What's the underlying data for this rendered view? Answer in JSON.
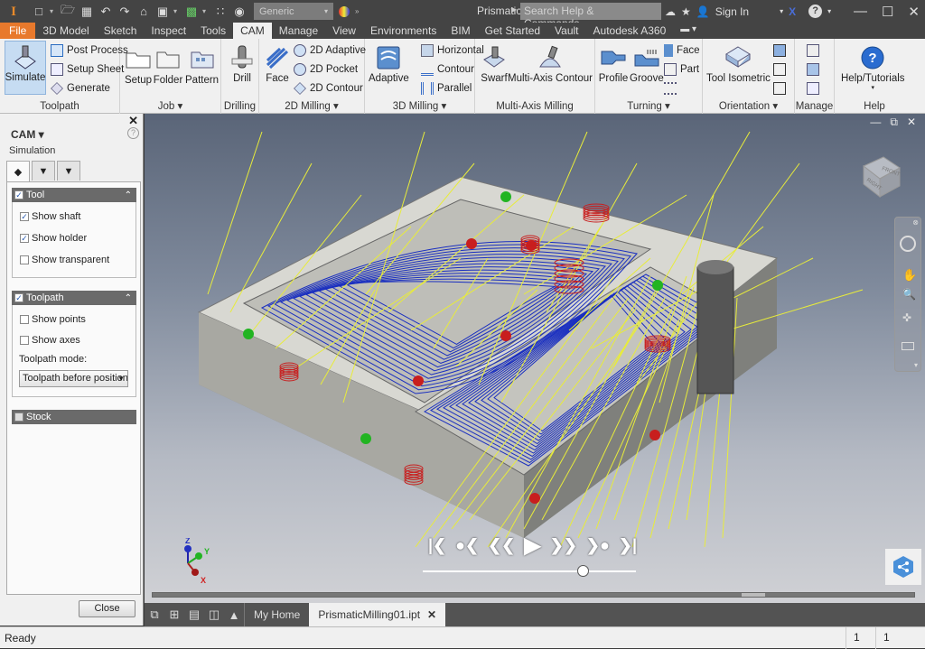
{
  "titlebar": {
    "app_logo": "I",
    "material": "Generic",
    "doc_title": "Prismatic...",
    "search_placeholder": "Search Help & Commands...",
    "sign_in": "Sign In"
  },
  "menu": {
    "tabs": [
      "File",
      "3D Model",
      "Sketch",
      "Inspect",
      "Tools",
      "CAM",
      "Manage",
      "View",
      "Environments",
      "BIM",
      "Get Started",
      "Vault",
      "Autodesk A360"
    ],
    "active": "CAM"
  },
  "ribbon": {
    "toolpath": {
      "label": "Toolpath",
      "simulate": "Simulate",
      "post_process": "Post Process",
      "setup_sheet": "Setup Sheet",
      "generate": "Generate"
    },
    "job": {
      "label": "Job ▾",
      "setup": "Setup",
      "folder": "Folder",
      "pattern": "Pattern"
    },
    "drilling": {
      "label": "Drilling",
      "drill": "Drill"
    },
    "milling2d": {
      "label": "2D Milling ▾",
      "face": "Face",
      "adaptive": "2D Adaptive",
      "pocket": "2D Pocket",
      "contour": "2D Contour"
    },
    "milling3d": {
      "label": "3D Milling ▾",
      "adaptive": "Adaptive",
      "horizontal": "Horizontal",
      "contour": "Contour",
      "parallel": "Parallel"
    },
    "multiaxis": {
      "label": "Multi-Axis Milling",
      "swarf": "Swarf",
      "contour": "Multi-Axis Contour"
    },
    "turning": {
      "label": "Turning ▾",
      "profile": "Profile",
      "groove": "Groove",
      "face": "Face",
      "part": "Part"
    },
    "orientation": {
      "label": "Orientation ▾",
      "tool_isometric": "Tool Isometric"
    },
    "manage": {
      "label": "Manage"
    },
    "help": {
      "label": "Help",
      "tutorials": "Help/Tutorials"
    }
  },
  "browser": {
    "title": "CAM ▾",
    "subtitle": "Simulation",
    "tool_group": {
      "label": "Tool",
      "checked": true,
      "options": [
        {
          "label": "Show shaft",
          "checked": true
        },
        {
          "label": "Show holder",
          "checked": true
        },
        {
          "label": "Show transparent",
          "checked": false
        }
      ]
    },
    "toolpath_group": {
      "label": "Toolpath",
      "checked": true,
      "options": [
        {
          "label": "Show points",
          "checked": false
        },
        {
          "label": "Show axes",
          "checked": false
        }
      ],
      "mode_label": "Toolpath mode:",
      "mode_value": "Toolpath before position"
    },
    "stock_group": {
      "label": "Stock",
      "checked": false
    },
    "close_label": "Close"
  },
  "viewport": {
    "viewcube_faces": [
      "FRONT",
      "RIGHT"
    ],
    "triad": {
      "x": "X",
      "y": "Y",
      "z": "Z"
    },
    "playback_progress": 0.75,
    "scroll_position": 0.78
  },
  "doctabs": {
    "home": "My Home",
    "file": "PrismaticMilling01.ipt"
  },
  "status": {
    "text": "Ready",
    "cell1": "1",
    "cell2": "1"
  },
  "colors": {
    "accent_file": "#e8792c",
    "toolpath_blue": "#1a2fc0",
    "rapid_yellow": "#e8ec3a",
    "plunge_red": "#c81e1e",
    "entry_green": "#22b422"
  }
}
